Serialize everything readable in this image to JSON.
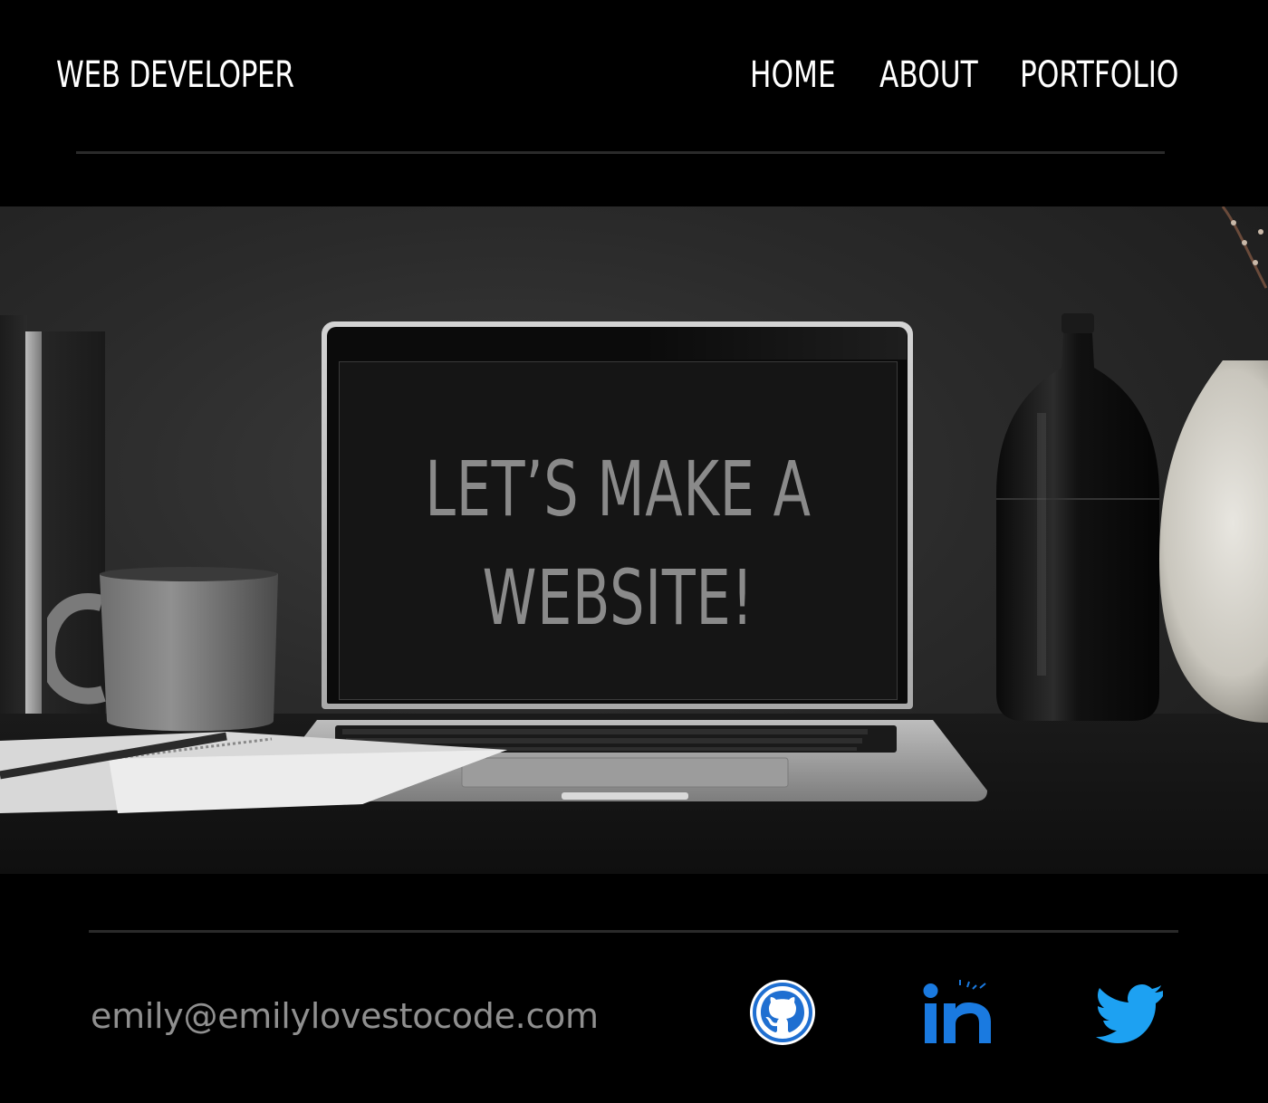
{
  "header": {
    "brand": "WEB DEVELOPER",
    "nav": {
      "home": "HOME",
      "about": "ABOUT",
      "portfolio": "PORTFOLIO"
    }
  },
  "hero": {
    "screen_line_1": "LET’S MAKE A",
    "screen_line_2": "WEBSITE!"
  },
  "footer": {
    "email": "emily@emilylovestocode.com",
    "social": {
      "github_icon": "github-icon",
      "linkedin_icon": "linkedin-icon",
      "twitter_icon": "twitter-icon"
    }
  },
  "colors": {
    "background": "#000000",
    "text": "#ffffff",
    "email_text": "#8f8f8f",
    "divider": "#2a2a2a",
    "screen_text": "#8a8a8a",
    "github_ring": "#1f6fd1",
    "linkedin_blue": "#1a7ae0",
    "twitter_blue": "#1da1f2"
  }
}
